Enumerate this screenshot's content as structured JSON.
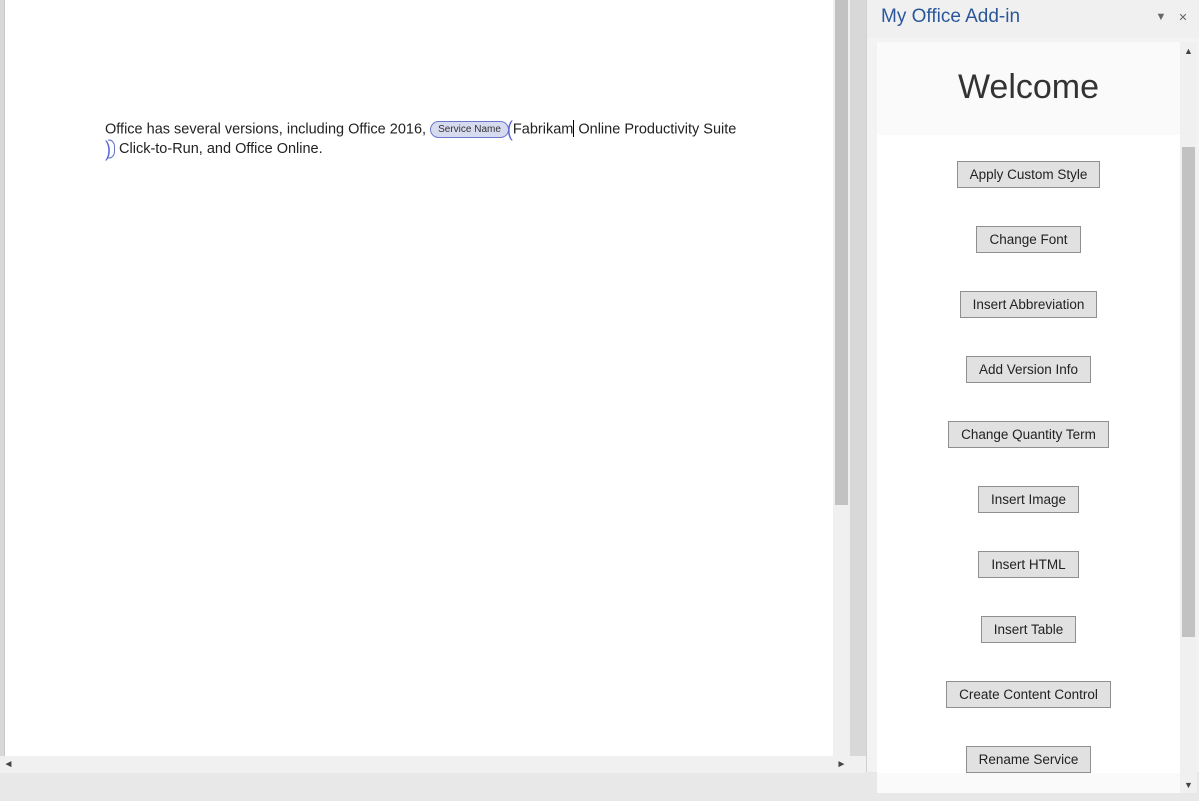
{
  "taskpane": {
    "title": "My Office Add-in",
    "banner": "Welcome",
    "buttons": [
      "Apply Custom Style",
      "Change Font",
      "Insert Abbreviation",
      "Add Version Info",
      "Change Quantity Term",
      "Insert Image",
      "Insert HTML",
      "Insert Table",
      "Create Content Control",
      "Rename Service"
    ]
  },
  "document": {
    "text_before": "Office has several versions, including Office 2016, ",
    "content_control_label": "Service Name",
    "cc_text_a": "Fabrikam",
    "cc_text_b": " Online Productivity Suite",
    "text_after": " Click-to-Run, and Office Online."
  }
}
